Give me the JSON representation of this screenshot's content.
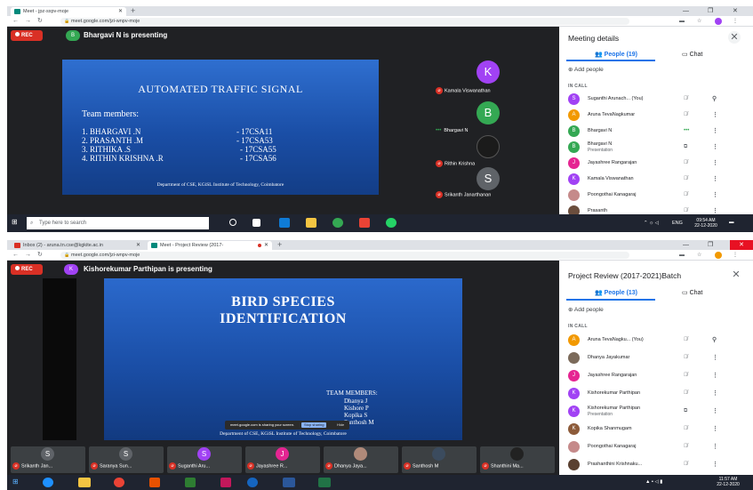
{
  "shot1": {
    "tabs": [
      {
        "label": "Meet - jpz-sxpv-moje"
      }
    ],
    "url": "meet.google.com/jzi-wnpv-moje",
    "rec_label": "REC",
    "presenter_initial": "B",
    "presenter_text": "Bhargavi N is presenting",
    "slide": {
      "title": "AUTOMATED TRAFFIC SIGNAL",
      "heading": "Team members:",
      "members": [
        {
          "name": "1. BHARGAVI .N",
          "id": "- 17CSA11"
        },
        {
          "name": "2. PRASANTH .M",
          "id": "- 17CSA53"
        },
        {
          "name": "3. RITHIKA .S",
          "id": "- 17CSA55"
        },
        {
          "name": "4. RITHIN KRISHNA .R",
          "id": "- 17CSA56"
        }
      ],
      "footer": "Department of CSE, KGiSL Institute of Technology, Coimbatore"
    },
    "tiles": [
      {
        "initial": "K",
        "name": "Kamala Viswanathan",
        "color": "#a142f4"
      },
      {
        "initial": "B",
        "name": "Bhargavi N",
        "color": "#34a853"
      },
      {
        "initial": "",
        "name": "Rithin Krishna",
        "color": "#1b1b1b"
      },
      {
        "initial": "S",
        "name": "Srikanth Janarthanan",
        "color": "#5f6368"
      }
    ],
    "panel": {
      "title": "Meeting details",
      "tab_people": "People (19)",
      "tab_chat": "Chat",
      "add_people": "Add people",
      "in_call": "IN CALL",
      "participants": [
        {
          "initial": "S",
          "name": "Suganthi Arunach... (You)",
          "sub": "",
          "color": "#a142f4",
          "mic": "mic-off",
          "extra": "pin"
        },
        {
          "initial": "A",
          "name": "Aruna TevaNagkumar",
          "sub": "",
          "color": "#f29900",
          "mic": "mic-off",
          "extra": "more"
        },
        {
          "initial": "B",
          "name": "Bhargavi N",
          "sub": "",
          "color": "#34a853",
          "mic": "speaking",
          "extra": "more"
        },
        {
          "initial": "B",
          "name": "Bhargavi N",
          "sub": "Presentation",
          "color": "#34a853",
          "mic": "present",
          "extra": "more"
        },
        {
          "initial": "J",
          "name": "Jayashree Rangarajan",
          "sub": "",
          "color": "#e52592",
          "mic": "mic-off",
          "extra": "more"
        },
        {
          "initial": "K",
          "name": "Kamala Viswanathan",
          "sub": "",
          "color": "#a142f4",
          "mic": "mic-off",
          "extra": "more"
        },
        {
          "initial": "",
          "name": "Poongothai Kanagaraj",
          "sub": "",
          "color": "#c58a8a",
          "mic": "mic-off",
          "extra": "more"
        },
        {
          "initial": "",
          "name": "Prasanth",
          "sub": "",
          "color": "#6b4e3d",
          "mic": "mic-off",
          "extra": "more"
        }
      ]
    },
    "taskbar": {
      "search_placeholder": "Type here to search",
      "time": "09:54 AM",
      "date": "22-12-2020",
      "lang": "ENG"
    }
  },
  "shot2": {
    "tabs": [
      {
        "label": "Inbox (2) - aruna.tn.cse@kgkite.ac.in",
        "fav_color": "#d93025"
      },
      {
        "label": "Meet - Project Review (2017-",
        "fav_color": "#00897b"
      }
    ],
    "url": "meet.google.com/jzi-wnpv-moje",
    "rec_label": "REC",
    "presenter_initial": "K",
    "presenter_text": "Kishorekumar Parthipan is presenting",
    "slide": {
      "title_line1": "BIRD SPECIES",
      "title_line2": "IDENTIFICATION",
      "heading": "TEAM MEMBERS:",
      "members": [
        "Dhanya J",
        "Kishore P",
        "Kopika S",
        "Santhosh M"
      ],
      "footer": "Department of CSE, KGiSL Institute of Technology, Coimbatore",
      "share_bar": "meet.google.com is sharing your screen.",
      "stop_sharing": "Stop sharing",
      "hide": "Hide"
    },
    "strip": [
      {
        "initial": "S",
        "name": "Srikanth Jan...",
        "color": "#5f6368"
      },
      {
        "initial": "S",
        "name": "Saranya Sun...",
        "color": "#5f6368"
      },
      {
        "initial": "S",
        "name": "Suganthi Aru...",
        "color": "#a142f4"
      },
      {
        "initial": "J",
        "name": "Jayashree R...",
        "color": "#e52592"
      },
      {
        "initial": "",
        "name": "Dhanya Jaya...",
        "color": "#b08a7a"
      },
      {
        "initial": "",
        "name": "Santhosh M",
        "color": "#3b4b5e"
      },
      {
        "initial": "",
        "name": "Shanthini Ma...",
        "color": "#222222"
      }
    ],
    "panel": {
      "title": "Project Review (2017-2021)Batch",
      "tab_people": "People (13)",
      "tab_chat": "Chat",
      "add_people": "Add people",
      "in_call": "IN CALL",
      "participants": [
        {
          "initial": "A",
          "name": "Aruna TevaNagku... (You)",
          "sub": "",
          "color": "#f29900",
          "mic": "mic-off",
          "extra": "pin"
        },
        {
          "initial": "",
          "name": "Dhanya Jayakumar",
          "sub": "",
          "color": "#7b6a5a",
          "mic": "mic-off",
          "extra": "more"
        },
        {
          "initial": "J",
          "name": "Jayashree Rangarajan",
          "sub": "",
          "color": "#e52592",
          "mic": "mic-off",
          "extra": "more"
        },
        {
          "initial": "K",
          "name": "Kishorekumar Parthipan",
          "sub": "",
          "color": "#a142f4",
          "mic": "mic-off",
          "extra": "more"
        },
        {
          "initial": "K",
          "name": "Kishorekumar Parthipan",
          "sub": "Presentation",
          "color": "#a142f4",
          "mic": "present",
          "extra": "more"
        },
        {
          "initial": "K",
          "name": "Kopika Shanmugam",
          "sub": "",
          "color": "#8d5b3a",
          "mic": "mic-off",
          "extra": "more"
        },
        {
          "initial": "",
          "name": "Poongothai Kanagaraj",
          "sub": "",
          "color": "#c58a8a",
          "mic": "mic-off",
          "extra": "more"
        },
        {
          "initial": "",
          "name": "Prashanthini Krishnaku...",
          "sub": "",
          "color": "#5a4030",
          "mic": "mic-off",
          "extra": "more"
        }
      ]
    },
    "taskbar": {
      "time": "11:57 AM",
      "date": "22-12-2020"
    }
  }
}
